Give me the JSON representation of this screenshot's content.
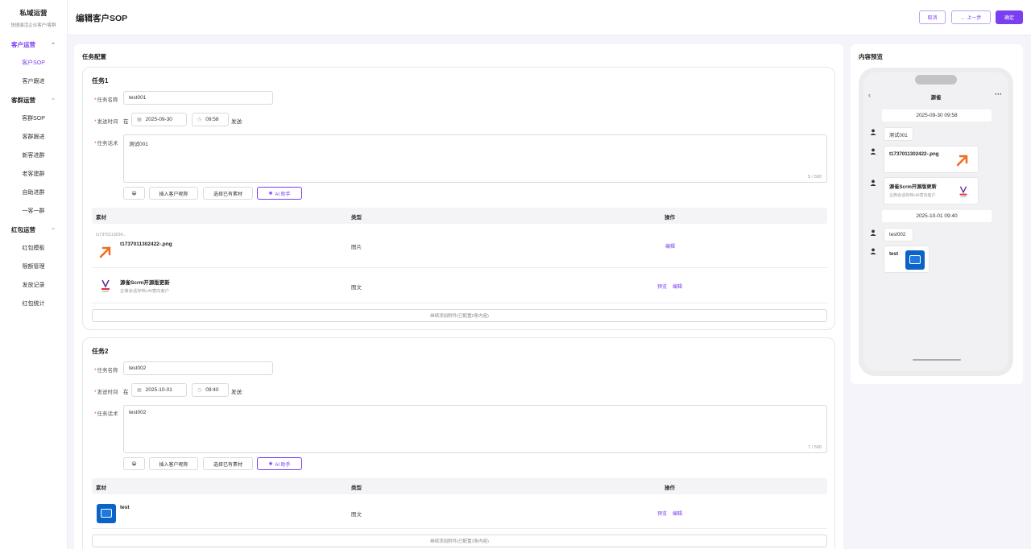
{
  "app": {
    "title": "私域运营",
    "subtitle": "快捷激活企业客户/客群"
  },
  "sidebar": {
    "groups": [
      {
        "label": "客户运营",
        "active": true,
        "items": [
          {
            "label": "客户SOP",
            "active": true
          },
          {
            "label": "客户跟进"
          }
        ]
      },
      {
        "label": "客群运营",
        "items": [
          {
            "label": "客群SOP"
          },
          {
            "label": "客群跟进"
          },
          {
            "label": "新客进群"
          },
          {
            "label": "老客建群"
          },
          {
            "label": "自助进群"
          },
          {
            "label": "一客一群"
          }
        ]
      },
      {
        "label": "红包运营",
        "items": [
          {
            "label": "红包模板"
          },
          {
            "label": "限额管理"
          },
          {
            "label": "发放记录"
          },
          {
            "label": "红包统计"
          }
        ]
      }
    ]
  },
  "header": {
    "title": "编辑客户SOP",
    "cancel": "取消",
    "prev": "← 上一步",
    "confirm": "确定"
  },
  "config": {
    "title": "任务配置"
  },
  "labels": {
    "name": "任务名称",
    "send_time": "发送时间",
    "at": "在",
    "send_suffix": "发送:",
    "script": "任务话术"
  },
  "toolbar": {
    "emoji": "😀",
    "insert_nick": "插入客户昵称",
    "select_material": "选择已有素材",
    "ai": "AI 助手"
  },
  "table": {
    "col_material": "素材",
    "col_type": "类型",
    "col_action": "操作"
  },
  "actions": {
    "preview": "预览",
    "edit": "编辑"
  },
  "tasks": [
    {
      "title": "任务1",
      "name": "test001",
      "date": "2025-09-30",
      "time": "09:58",
      "script": "测试001",
      "count": "5 / 500",
      "rows": [
        {
          "caption": "t17370113024...",
          "name": "t1737011302422-.png",
          "type": "图片"
        },
        {
          "name": "源雀Scrm开源版更新",
          "desc": "企微会话存档+AI意向客户",
          "type": "图文"
        }
      ],
      "add_more": "继续添加附件(已配置2条内容)"
    },
    {
      "title": "任务2",
      "name": "test002",
      "date": "2025-10-01",
      "time": "09:40",
      "script": "test002",
      "count": "7 / 500",
      "rows": [
        {
          "name": "test",
          "type": "图文"
        }
      ],
      "add_more": "继续添加附件(已配置1条内容)"
    }
  ],
  "preview": {
    "title": "内容预览",
    "chat_title": "源雀",
    "messages": {
      "ts1": "2025-09-30 09:58",
      "m1": "测试001",
      "m2": "t1737011302422-.png",
      "m3_title": "源雀Scrm开源版更新",
      "m3_desc": "企微会话存档+AI意向客户",
      "ts2": "2025-10-01 09:40",
      "m4": "test002",
      "m5": "test"
    }
  },
  "colors": {
    "accent": "#7b3ff2",
    "arrow": "#f26b21",
    "tile": "#0b63c8"
  }
}
